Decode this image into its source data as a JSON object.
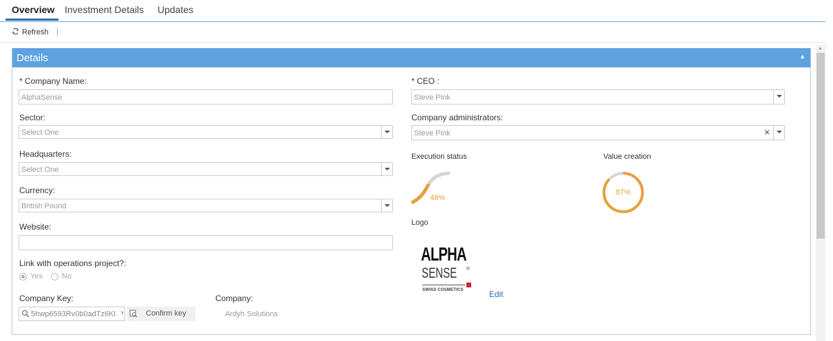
{
  "tabs": [
    {
      "label": "Overview",
      "active": true
    },
    {
      "label": "Investment Details",
      "active": false
    },
    {
      "label": "Updates",
      "active": false
    }
  ],
  "toolbar": {
    "refresh_label": "Refresh"
  },
  "panel": {
    "title": "Details"
  },
  "form": {
    "company_name": {
      "label": "* Company Name:",
      "value": "AlphaSense"
    },
    "sector": {
      "label": "Sector:",
      "value": "Select One"
    },
    "headquarters": {
      "label": "Headquarters:",
      "value": "Select One"
    },
    "currency": {
      "label": "Currency:",
      "value": "British Pound"
    },
    "website": {
      "label": "Website:",
      "value": ""
    },
    "link_ops": {
      "label": "Link with operations project?:",
      "options": [
        "Yes",
        "No"
      ],
      "selected": "Yes"
    },
    "company_key": {
      "label": "Company Key:",
      "value": "5hwp6593Rv0b0adTz6Kl"
    },
    "confirm_key_label": "Confirm key",
    "company": {
      "label": "Company:",
      "value": "Ardyh Solutions"
    },
    "ceo": {
      "label": "* CEO :",
      "value": "Steve Pink"
    },
    "administrators": {
      "label": "Company administrators:",
      "value": "Steve Pink"
    }
  },
  "metrics": {
    "execution": {
      "label": "Execution status",
      "percent": 48,
      "text": "48%"
    },
    "value_creation": {
      "label": "Value creation",
      "percent": 87,
      "text": "87%"
    }
  },
  "logo": {
    "label": "Logo",
    "line1": "ALPHA",
    "line2": "SENSE",
    "registered": "®",
    "tagline": "SWISS COSMETICS",
    "edit_label": "Edit"
  },
  "colors": {
    "accent": "#5ea3e0",
    "gauge": "#e8a03c",
    "link": "#2a6fb3"
  }
}
